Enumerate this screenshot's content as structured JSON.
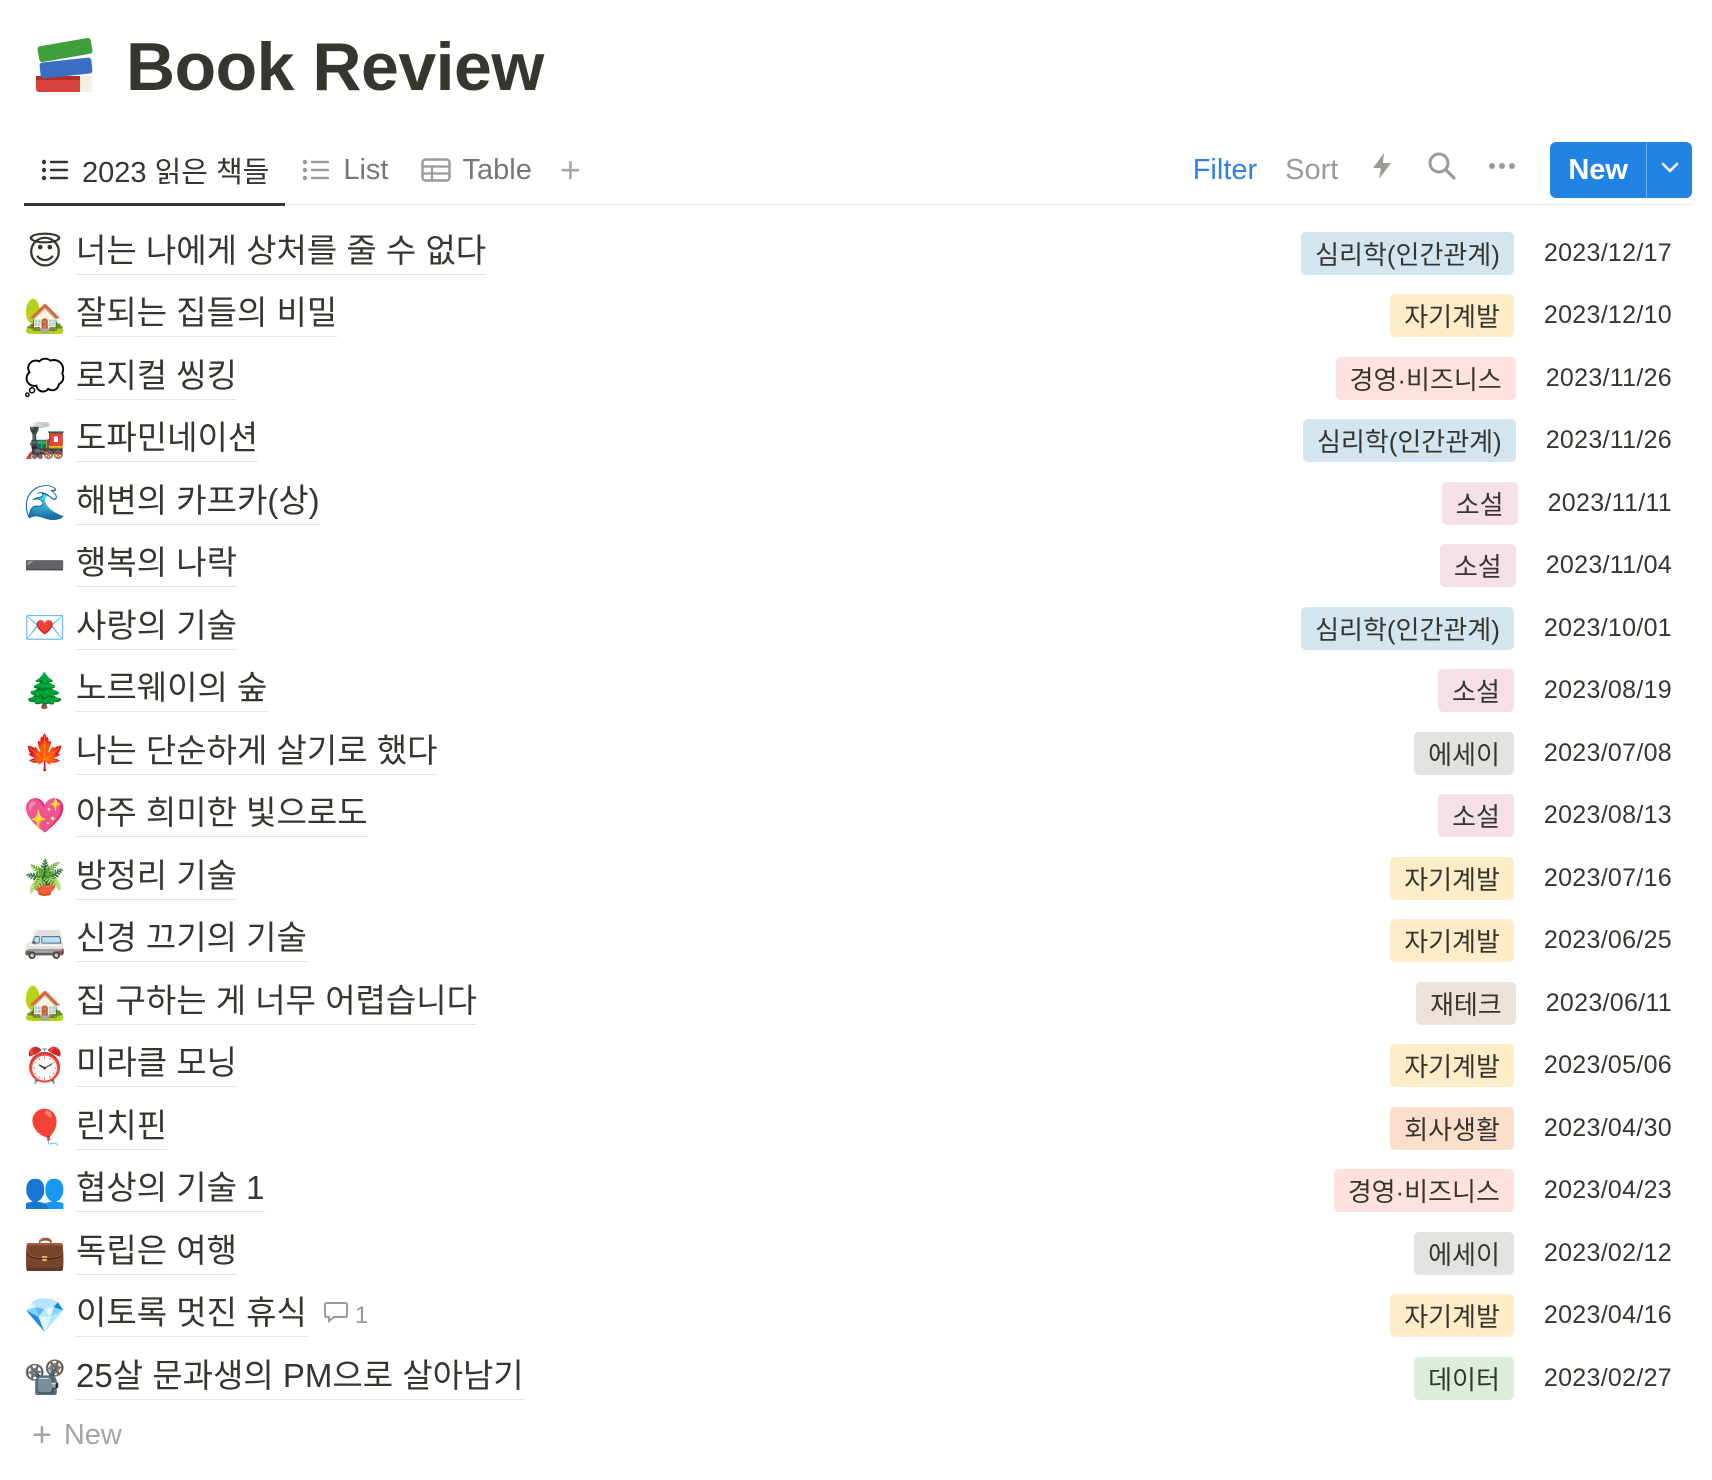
{
  "page": {
    "title": "Book Review",
    "icon": "books-icon"
  },
  "views": {
    "tabs": [
      {
        "label": "2023 읽은 책들",
        "icon": "list-icon",
        "active": true
      },
      {
        "label": "List",
        "icon": "list-icon",
        "active": false
      },
      {
        "label": "Table",
        "icon": "table-icon",
        "active": false
      }
    ],
    "add_view": "+"
  },
  "actions": {
    "filter": "Filter",
    "sort": "Sort",
    "automation_icon": "lightning-icon",
    "search_icon": "search-icon",
    "more_icon": "more-horizontal-icon",
    "new": "New",
    "new_caret_icon": "chevron-down-icon"
  },
  "colors": {
    "accent": "#2383e2",
    "filter_active": "#2f80ed",
    "tag_psych": "#d3e5ef",
    "tag_self": "#fbecdd",
    "tag_biz": "#ffe2dd",
    "tag_novel": "#f5e0e9",
    "tag_essay": "#e3e2e0",
    "tag_finance": "#eee0da",
    "tag_work": "#fadec9",
    "tag_data": "#dbeddb"
  },
  "books": [
    {
      "icon": "😇",
      "title": "너는 나에게 상처를 줄 수 없다",
      "tag": "심리학(인간관계)",
      "tag_color": "#d3e5ef",
      "date": "2023/12/17"
    },
    {
      "icon": "🏡",
      "title": "잘되는 집들의 비밀",
      "tag": "자기계발",
      "tag_color": "#fdecc8",
      "date": "2023/12/10"
    },
    {
      "icon": "💭",
      "title": "로지컬 씽킹",
      "tag": "경영·비즈니스",
      "tag_color": "#ffe2dd",
      "date": "2023/11/26"
    },
    {
      "icon": "🚂",
      "title": "도파민네이션",
      "tag": "심리학(인간관계)",
      "tag_color": "#d3e5ef",
      "date": "2023/11/26"
    },
    {
      "icon": "🌊",
      "title": "해변의 카프카(상)",
      "tag": "소설",
      "tag_color": "#f5e0e9",
      "date": "2023/11/11"
    },
    {
      "icon": "➖",
      "title": "행복의 나락",
      "tag": "소설",
      "tag_color": "#f5e0e9",
      "date": "2023/11/04"
    },
    {
      "icon": "💌",
      "title": "사랑의 기술",
      "tag": "심리학(인간관계)",
      "tag_color": "#d3e5ef",
      "date": "2023/10/01"
    },
    {
      "icon": "🌲",
      "title": "노르웨이의 숲",
      "tag": "소설",
      "tag_color": "#f5e0e9",
      "date": "2023/08/19"
    },
    {
      "icon": "🍁",
      "title": "나는 단순하게 살기로 했다",
      "tag": "에세이",
      "tag_color": "#e3e2e0",
      "date": "2023/07/08"
    },
    {
      "icon": "💖",
      "title": "아주 희미한 빛으로도",
      "tag": "소설",
      "tag_color": "#f5e0e9",
      "date": "2023/08/13"
    },
    {
      "icon": "🪴",
      "title": "방정리 기술",
      "tag": "자기계발",
      "tag_color": "#fdecc8",
      "date": "2023/07/16"
    },
    {
      "icon": "🚐",
      "title": "신경 끄기의 기술",
      "tag": "자기계발",
      "tag_color": "#fdecc8",
      "date": "2023/06/25"
    },
    {
      "icon": "🏡",
      "title": "집 구하는 게 너무 어렵습니다",
      "tag": "재테크",
      "tag_color": "#eee0da",
      "date": "2023/06/11"
    },
    {
      "icon": "⏰",
      "title": "미라클 모닝",
      "tag": "자기계발",
      "tag_color": "#fdecc8",
      "date": "2023/05/06"
    },
    {
      "icon": "🎈",
      "title": "린치핀",
      "tag": "회사생활",
      "tag_color": "#fadec9",
      "date": "2023/04/30"
    },
    {
      "icon": "👥",
      "title": "협상의 기술 1",
      "tag": "경영·비즈니스",
      "tag_color": "#ffe2dd",
      "date": "2023/04/23"
    },
    {
      "icon": "💼",
      "title": "독립은 여행",
      "tag": "에세이",
      "tag_color": "#e3e2e0",
      "date": "2023/02/12"
    },
    {
      "icon": "💎",
      "title": "이토록 멋진 휴식",
      "tag": "자기계발",
      "tag_color": "#fdecc8",
      "date": "2023/04/16",
      "comments": "1"
    },
    {
      "icon": "📽️",
      "title": "25살 문과생의 PM으로 살아남기",
      "tag": "데이터",
      "tag_color": "#dbeddb",
      "date": "2023/02/27"
    }
  ],
  "footer": {
    "new_label": "New"
  }
}
